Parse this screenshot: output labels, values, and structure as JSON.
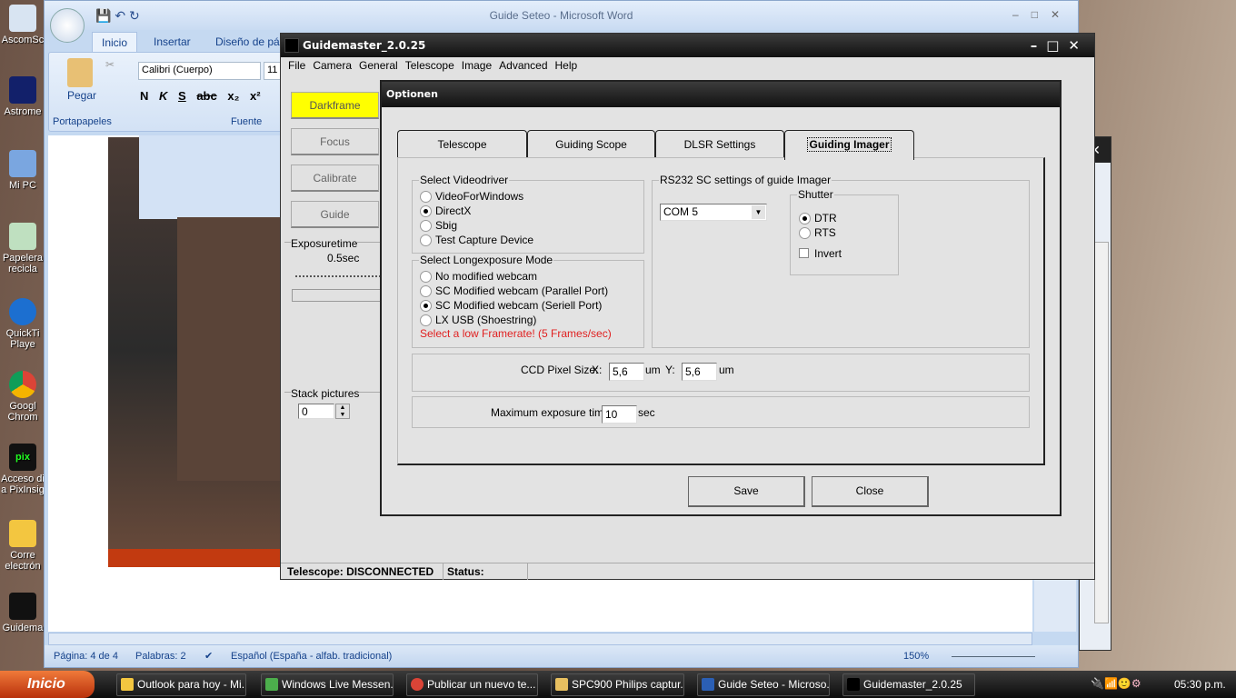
{
  "desktop": {
    "icons": [
      "AscomSc",
      "Astrome",
      "Mi PC",
      "Papelera recicla",
      "QuickTi Playe",
      "Googl Chrom",
      "Acceso di a PixInsig",
      "Corre electrón",
      "Guidema"
    ]
  },
  "word": {
    "title": "Guide Seteo - Microsoft Word",
    "tabs": [
      "Inicio",
      "Insertar",
      "Diseño de pág"
    ],
    "paste": "Pegar",
    "clipboard_group": "Portapapeles",
    "font_group": "Fuente",
    "font_name": "Calibri (Cuerpo)",
    "font_size": "11",
    "format_buttons": [
      "N",
      "K",
      "S",
      "abc",
      "x₂",
      "x²"
    ],
    "status": {
      "page": "Página: 4 de 4",
      "words": "Palabras: 2",
      "language": "Español (España - alfab. tradicional)",
      "zoom": "150%"
    }
  },
  "guidemaster": {
    "title": "Guidemaster_2.0.25",
    "menu": [
      "File",
      "Camera",
      "General",
      "Telescope",
      "Image",
      "Advanced",
      "Help"
    ],
    "buttons": {
      "darkframe": "Darkframe",
      "focus": "Focus",
      "calibrate": "Calibrate",
      "guide": "Guide"
    },
    "exposure": {
      "label": "Exposuretime",
      "value": "0.5sec"
    },
    "stack": {
      "label": "Stack pictures",
      "value": "0"
    },
    "status": {
      "telescope": "Telescope: DISCONNECTED",
      "status": "Status:"
    },
    "accent": "#ffff00"
  },
  "dialog": {
    "title": "Optionen",
    "tabs": [
      "Telescope",
      "Guiding Scope",
      "DLSR Settings",
      "Guiding Imager"
    ],
    "active_tab": "Guiding Imager",
    "videodriver": {
      "label": "Select Videodriver",
      "options": [
        "VideoForWindows",
        "DirectX",
        "Sbig",
        "Test Capture Device"
      ],
      "selected": "DirectX"
    },
    "longexposure": {
      "label": "Select Longexposure Mode",
      "options": [
        "No modified webcam",
        "SC Modified webcam (Parallel Port)",
        "SC Modified webcam (Seriell Port)",
        "LX USB (Shoestring)"
      ],
      "selected": "SC Modified webcam (Seriell Port)",
      "warning": "Select a low Framerate! (5 Frames/sec)",
      "warning_color": "#e02020"
    },
    "rs232": {
      "label": "RS232 SC settings of guide Imager",
      "port": "COM 5",
      "shutter_label": "Shutter",
      "shutter_options": [
        "DTR",
        "RTS"
      ],
      "shutter_selected": "DTR",
      "invert_label": "Invert",
      "invert_checked": false
    },
    "pixel": {
      "label": "CCD Pixel Size:",
      "x_label": "X:",
      "x": "5,6",
      "y_label": "Y:",
      "y": "5,6",
      "unit": "um"
    },
    "maxexp": {
      "label": "Maximum exposure time:",
      "value": "10",
      "unit": "sec"
    },
    "save": "Save",
    "close": "Close"
  },
  "taskbar": {
    "start": "Inicio",
    "items": [
      "Outlook para hoy - Mi...",
      "Windows Live Messen...",
      "Publicar un nuevo te...",
      "SPC900 Philips captur...",
      "Guide Seteo - Microso...",
      "Guidemaster_2.0.25"
    ],
    "clock": "05:30 p.m."
  }
}
